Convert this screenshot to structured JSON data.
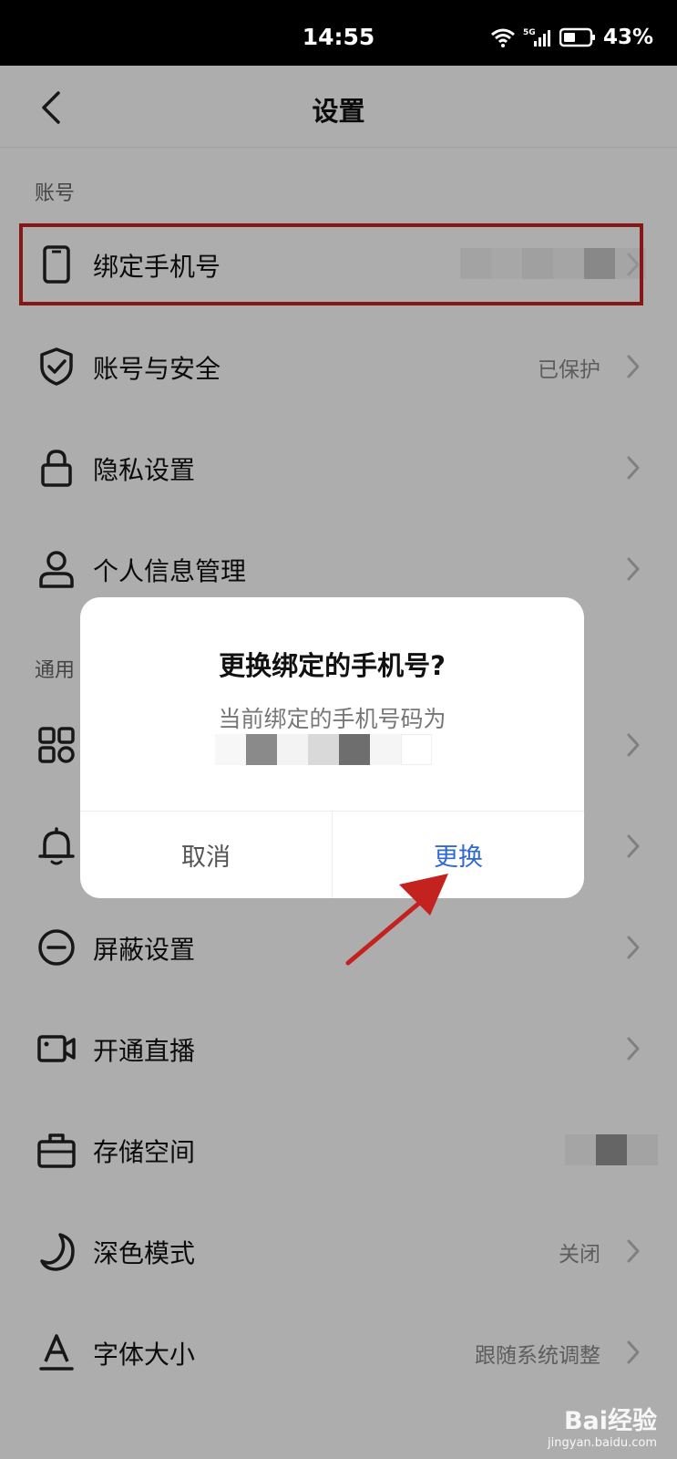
{
  "status_bar": {
    "time": "14:55",
    "network": "5G",
    "battery": "43%"
  },
  "nav": {
    "title": "设置"
  },
  "sections": {
    "account": "账号",
    "general": "通用"
  },
  "rows": {
    "bind_phone": {
      "label": "绑定手机号",
      "value": ""
    },
    "account_security": {
      "label": "账号与安全",
      "value": "已保护"
    },
    "privacy": {
      "label": "隐私设置",
      "value": ""
    },
    "personal_info": {
      "label": "个人信息管理",
      "value": ""
    },
    "block": {
      "label": "屏蔽设置",
      "value": ""
    },
    "live": {
      "label": "开通直播",
      "value": ""
    },
    "storage": {
      "label": "存储空间",
      "value": ""
    },
    "dark_mode": {
      "label": "深色模式",
      "value": "关闭"
    },
    "font_size": {
      "label": "字体大小",
      "value": "跟随系统调整"
    }
  },
  "dialog": {
    "title": "更换绑定的手机号?",
    "message": "当前绑定的手机号码为",
    "cancel": "取消",
    "confirm": "更换"
  },
  "watermark": {
    "brand": "Bai经验",
    "url": "jingyan.baidu.com"
  },
  "colors": {
    "accent_blue": "#2f6ad0",
    "highlight_red": "#c4221e"
  },
  "icons": {
    "back": "chevron-left-icon",
    "phone": "phone-icon",
    "shield": "shield-check-icon",
    "lock": "lock-icon",
    "person": "person-icon",
    "apps": "apps-grid-icon",
    "bell": "bell-icon",
    "block": "minus-circle-icon",
    "video": "video-camera-icon",
    "storage": "toolbox-icon",
    "moon": "moon-icon",
    "font": "font-a-icon",
    "chevron": "chevron-right-icon"
  }
}
